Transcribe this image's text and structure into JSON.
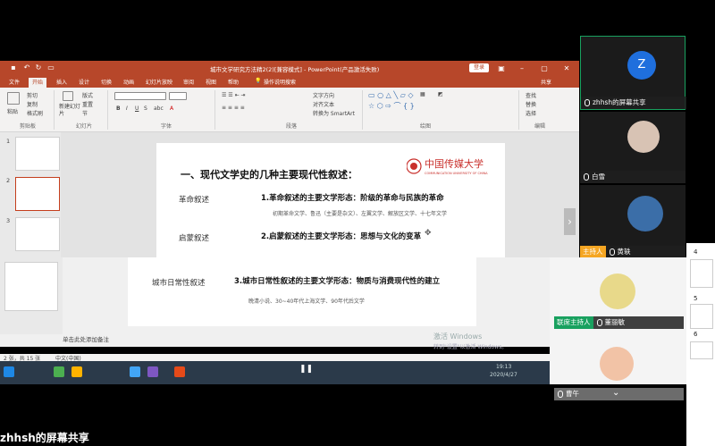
{
  "app": {
    "window_title": "城市文学研究方法精2(2)[兼容模式] - PowerPoint(产品激活失败)",
    "login_label": "登录",
    "share_label": "共享"
  },
  "ribbon": {
    "tabs": [
      "文件",
      "开始",
      "插入",
      "设计",
      "切换",
      "动画",
      "幻灯片放映",
      "审阅",
      "视图",
      "帮助",
      "操作说明搜索"
    ],
    "active_tab": "开始",
    "paste": "粘贴",
    "cut": "剪切",
    "copy": "复制",
    "format_painter": "格式刷",
    "new_slide": "新建幻灯片",
    "reuse": "重用幻灯片",
    "layout": "版式",
    "reset": "重置",
    "section": "节",
    "text_direction": "文字方向",
    "align_text": "对齐文本",
    "smartart": "转换为 SmartArt",
    "find": "查找",
    "replace": "替换",
    "select": "选择",
    "groups": {
      "clipboard": "剪贴板",
      "slides": "幻灯片",
      "font": "字体",
      "paragraph": "段落",
      "drawing": "绘图",
      "editing": "编辑"
    }
  },
  "slide": {
    "heading": "一、现代文学史的几种主要现代性叙述：",
    "logo_text": "中国传媒大学",
    "logo_sub": "COMMUNICATION UNIVERSITY OF CHINA",
    "rows": [
      {
        "label": "革命叙述",
        "head": "1.革命叙述的主要文学形态：阶级的革命与民族的革命",
        "sub": "初期革命文学、鲁迅（主要是杂文）、左翼文学、解放区文学、十七年文学"
      },
      {
        "label": "启蒙叙述",
        "head": "2.启蒙叙述的主要文学形态：思想与文化的变革",
        "sub": ""
      },
      {
        "label": "城市日常性叙述",
        "head": "3.城市日常性叙述的主要文学形态：物质与消费现代性的建立",
        "sub": "晚清小说、30~40年代上海文学、90年代后文学"
      }
    ]
  },
  "thumbs": [
    "1",
    "2",
    "3",
    "4",
    "5",
    "6"
  ],
  "notes_placeholder": "单击此处添加备注",
  "status": {
    "slide_count": "2 张，共 15 张",
    "language": "中文(中国)"
  },
  "watermark": {
    "line1": "激活 Windows",
    "line2": "转到\"设置\"以激活 Windows。"
  },
  "taskbar": {
    "time": "19:13",
    "date": "2020/4/27"
  },
  "participants": [
    {
      "initial": "Z",
      "name": "zhhsh的屏幕共享",
      "role": ""
    },
    {
      "initial": "",
      "name": "白雪",
      "role": ""
    },
    {
      "initial": "",
      "name": "黄轶",
      "role": "主持人"
    },
    {
      "initial": "",
      "name": "董丽敏",
      "role": "联席主持人"
    },
    {
      "initial": "",
      "name": "曹午",
      "role": ""
    }
  ],
  "bottom_share_label": "zhhsh的屏幕共享",
  "colors": {
    "ppt_red": "#b7472a",
    "host_orange": "#f5a623",
    "cohost_green": "#19a15f",
    "avatar_blue": "#1f6fdd"
  }
}
